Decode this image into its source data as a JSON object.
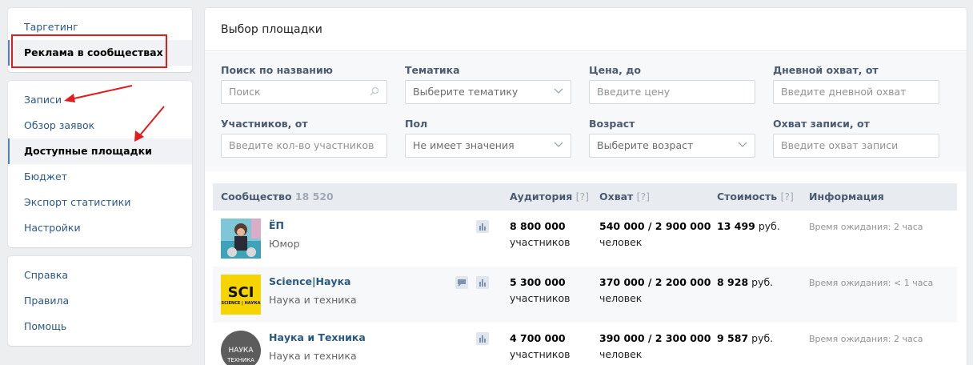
{
  "nav": {
    "group1": [
      "Таргетинг",
      "Реклама в сообществах"
    ],
    "group2": [
      "Записи",
      "Обзор заявок",
      "Доступные площадки",
      "Бюджет",
      "Экспорт статистики",
      "Настройки"
    ],
    "group3": [
      "Справка",
      "Правила",
      "Помощь"
    ]
  },
  "main": {
    "title": "Выбор площадки"
  },
  "filters": {
    "name_label": "Поиск по названию",
    "name_placeholder": "Поиск",
    "topic_label": "Тематика",
    "topic_value": "Выберите тематику",
    "price_label": "Цена, до",
    "price_placeholder": "Введите цену",
    "daily_label": "Дневной охват, от",
    "daily_placeholder": "Введите дневной охват",
    "members_label": "Участников, от",
    "members_placeholder": "Введите кол-во участников",
    "gender_label": "Пол",
    "gender_value": "Не имеет значения",
    "age_label": "Возраст",
    "age_value": "Выберите возраст",
    "post_reach_label": "Охват записи, от",
    "post_reach_placeholder": "Введите охват записи"
  },
  "table": {
    "headers": {
      "community": "Сообщество",
      "community_count": "18 520",
      "audience": "Аудитория",
      "reach": "Охват",
      "cost": "Стоимость",
      "info": "Информация",
      "help_mark": "[?]"
    },
    "rows": [
      {
        "name": "ЁП",
        "topic": "Юмор",
        "audience": "8 800 000",
        "audience_unit": "участников",
        "reach": "540 000 / 2 900 000",
        "reach_unit": "человек",
        "cost": "13 499",
        "currency": "руб.",
        "info": "Время ожидания: 2 часа"
      },
      {
        "name": "Science|Наука",
        "topic": "Наука и техника",
        "audience": "5 300 000",
        "audience_unit": "участников",
        "reach": "370 000 / 2 200 000",
        "reach_unit": "человек",
        "cost": "8 928",
        "currency": "руб.",
        "info": "Время ожидания: < 1 часа",
        "avatar_text": "SCI",
        "avatar_subtext": "SCIENCE | НАУКА"
      },
      {
        "name": "Наука и Техника",
        "topic": "Наука и техника",
        "audience": "4 700 000",
        "audience_unit": "участников",
        "reach": "390 000 / 2 300 000",
        "reach_unit": "человек",
        "cost": "9 587",
        "currency": "руб.",
        "info": "Время ожидания: 2 часа",
        "avatar_text": "НАУКА",
        "avatar_subtext": "ТЕХНИКА"
      }
    ]
  },
  "colors": {
    "link": "#2a5885",
    "annotation": "#e01c1c",
    "header_bg": "#e8ecf0",
    "accent": "#5181b8"
  }
}
